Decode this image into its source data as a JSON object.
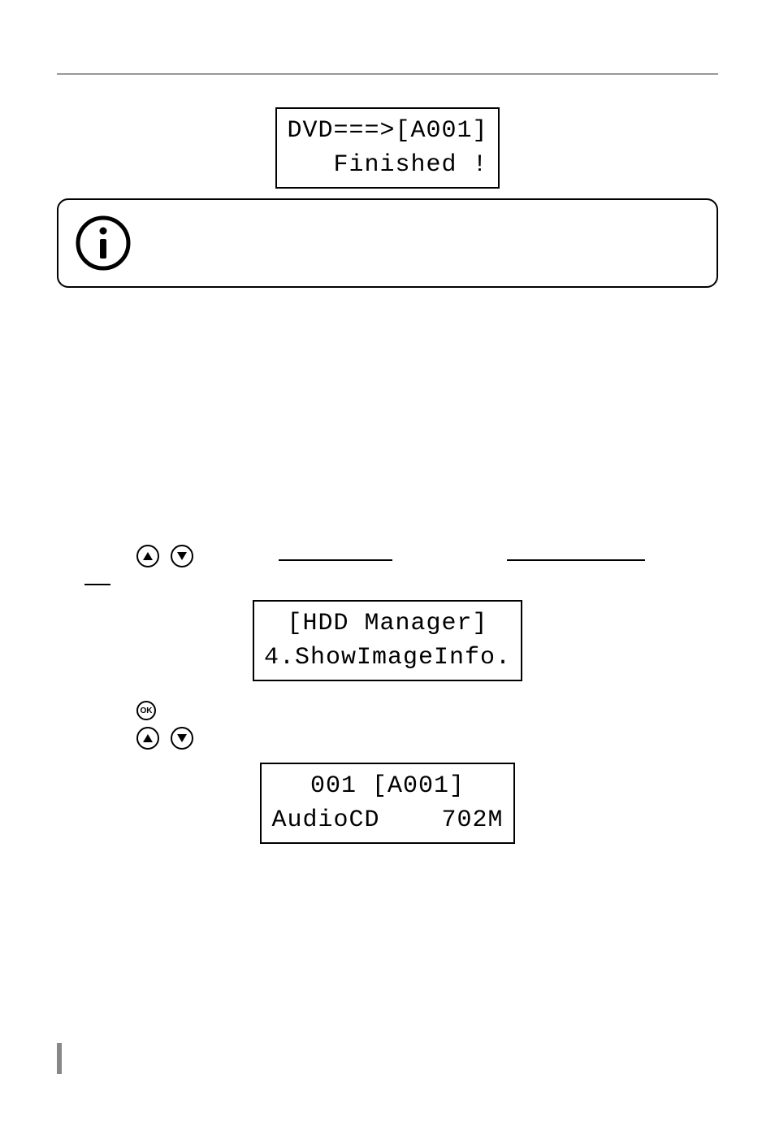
{
  "lcd1": {
    "line1": "DVD===>[A001]",
    "line2": "   Finished !"
  },
  "info_icon": "info-icon",
  "lcd2": {
    "line1": "[HDD Manager]",
    "line2": "4.ShowImageInfo."
  },
  "lcd3": {
    "line1": "001 [A001]",
    "line2": "AudioCD    702M"
  },
  "icons": {
    "up": "up-arrow-icon",
    "down": "down-arrow-icon",
    "ok": "OK"
  }
}
